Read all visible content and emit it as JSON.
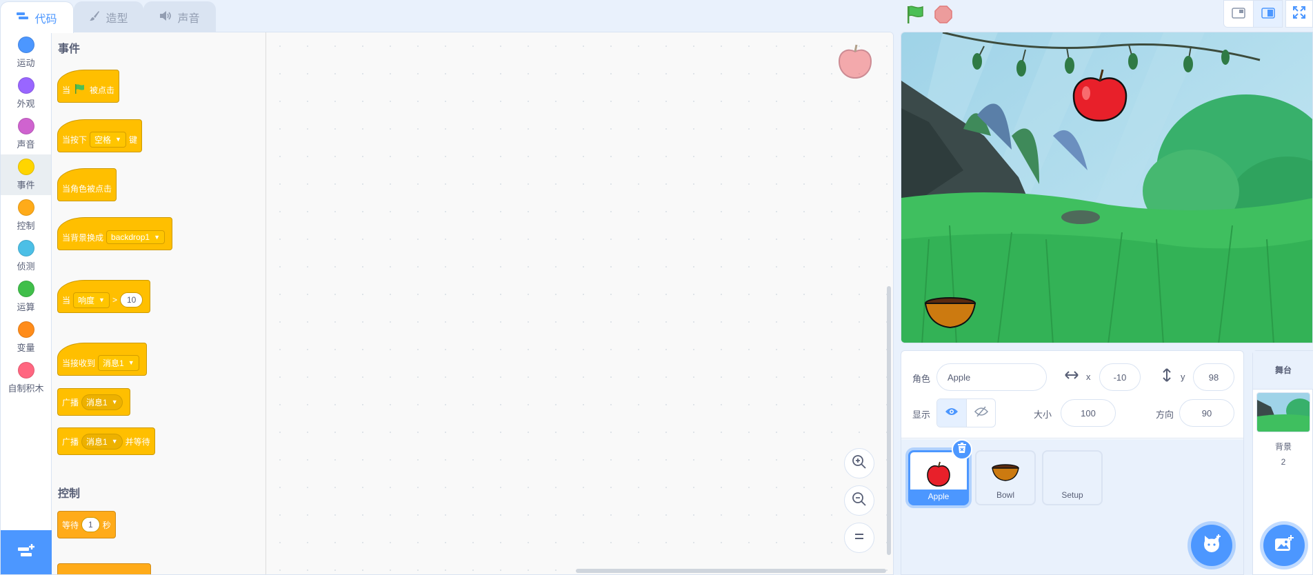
{
  "tabs": [
    {
      "label": "代码",
      "icon": "code-icon"
    },
    {
      "label": "造型",
      "icon": "paintbrush-icon"
    },
    {
      "label": "声音",
      "icon": "speaker-icon"
    }
  ],
  "categories": [
    {
      "label": "运动",
      "color": "#4c97ff"
    },
    {
      "label": "外观",
      "color": "#9966ff"
    },
    {
      "label": "声音",
      "color": "#cf63cf"
    },
    {
      "label": "事件",
      "color": "#ffd500"
    },
    {
      "label": "控制",
      "color": "#ffab19"
    },
    {
      "label": "侦测",
      "color": "#4cbfe6"
    },
    {
      "label": "运算",
      "color": "#40bf4a"
    },
    {
      "label": "变量",
      "color": "#ff8c1a"
    },
    {
      "label": "自制积木",
      "color": "#ff6680"
    }
  ],
  "flyout": {
    "events_title": "事件",
    "control_title": "控制",
    "blocks": {
      "when_flag_pre": "当",
      "when_flag_post": "被点击",
      "when_key_pre": "当按下",
      "when_key_dd": "空格",
      "when_key_post": "键",
      "when_sprite_clicked": "当角色被点击",
      "when_backdrop_pre": "当背景换成",
      "when_backdrop_dd": "backdrop1",
      "when_loudness_pre": "当",
      "when_loudness_dd": "响度",
      "when_loudness_op": ">",
      "when_loudness_val": "10",
      "when_receive_pre": "当接收到",
      "when_receive_dd": "消息1",
      "broadcast_pre": "广播",
      "broadcast_dd": "消息1",
      "broadcast_wait_pre": "广播",
      "broadcast_wait_dd": "消息1",
      "broadcast_wait_post": "并等待",
      "wait_pre": "等待",
      "wait_val": "1",
      "wait_post": "秒"
    }
  },
  "sprite_info": {
    "sprite_label": "角色",
    "sprite_name": "Apple",
    "x_label": "x",
    "x_value": "-10",
    "y_label": "y",
    "y_value": "98",
    "show_label": "显示",
    "size_label": "大小",
    "size_value": "100",
    "direction_label": "方向",
    "direction_value": "90"
  },
  "sprites": [
    {
      "name": "Apple",
      "selected": true
    },
    {
      "name": "Bowl",
      "selected": false
    },
    {
      "name": "Setup",
      "selected": false
    }
  ],
  "stage_panel": {
    "title": "舞台",
    "backdrops_label": "背景",
    "backdrops_count": "2"
  },
  "colors": {
    "accent": "#4c97ff",
    "events": "#ffbf00",
    "control": "#ffab19"
  }
}
